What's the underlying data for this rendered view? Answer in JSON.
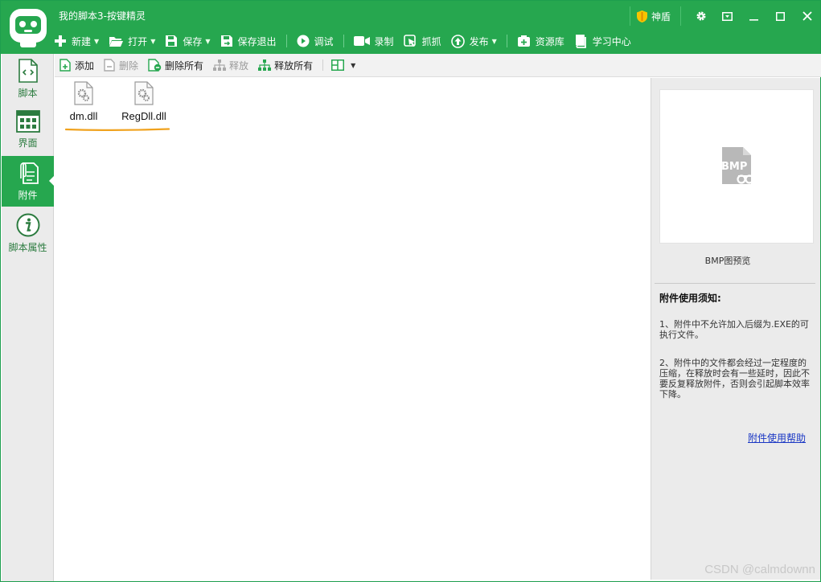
{
  "window": {
    "title": "我的脚本3-按键精灵"
  },
  "toolbar": {
    "items": [
      {
        "label": "新建",
        "icon": "plus-icon",
        "dropdown": true
      },
      {
        "label": "打开",
        "icon": "folder-open-icon",
        "dropdown": true
      },
      {
        "label": "保存",
        "icon": "save-icon",
        "dropdown": true
      },
      {
        "label": "保存退出",
        "icon": "save-exit-icon",
        "dropdown": false
      },
      {
        "label": "调试",
        "icon": "play-icon",
        "dropdown": false
      },
      {
        "label": "录制",
        "icon": "video-camera-icon",
        "dropdown": false
      },
      {
        "label": "抓抓",
        "icon": "grab-icon",
        "dropdown": false
      },
      {
        "label": "发布",
        "icon": "publish-icon",
        "dropdown": true
      },
      {
        "label": "资源库",
        "icon": "resource-icon",
        "dropdown": false
      },
      {
        "label": "学习中心",
        "icon": "book-icon",
        "dropdown": false
      }
    ]
  },
  "window_controls": {
    "shield_label": "神盾"
  },
  "sidebar": {
    "items": [
      {
        "label": "脚本",
        "icon": "script-file-icon",
        "active": false
      },
      {
        "label": "界面",
        "icon": "grid-layout-icon",
        "active": false
      },
      {
        "label": "附件",
        "icon": "attachment-icon",
        "active": true
      },
      {
        "label": "脚本属性",
        "icon": "info-icon",
        "active": false
      }
    ]
  },
  "subtoolbar": {
    "add": "添加",
    "delete": "删除",
    "delete_all": "删除所有",
    "release": "释放",
    "release_all": "释放所有"
  },
  "files": [
    {
      "name": "dm.dll"
    },
    {
      "name": "RegDll.dll"
    }
  ],
  "right_panel": {
    "preview_badge": "BMP",
    "preview_caption": "BMP图预览",
    "notice_title": "附件使用须知:",
    "notice_1": "1、附件中不允许加入后缀为.EXE的可执行文件。",
    "notice_2": "2、附件中的文件都会经过一定程度的压缩，在释放时会有一些延时，因此不要反复释放附件，否则会引起脚本效率下降。",
    "help_link": "附件使用帮助"
  },
  "watermark": "CSDN @calmdownn",
  "colors": {
    "brand_green": "#26a74f",
    "link_blue": "#1a37c4",
    "highlight_orange": "#f0a21e"
  }
}
